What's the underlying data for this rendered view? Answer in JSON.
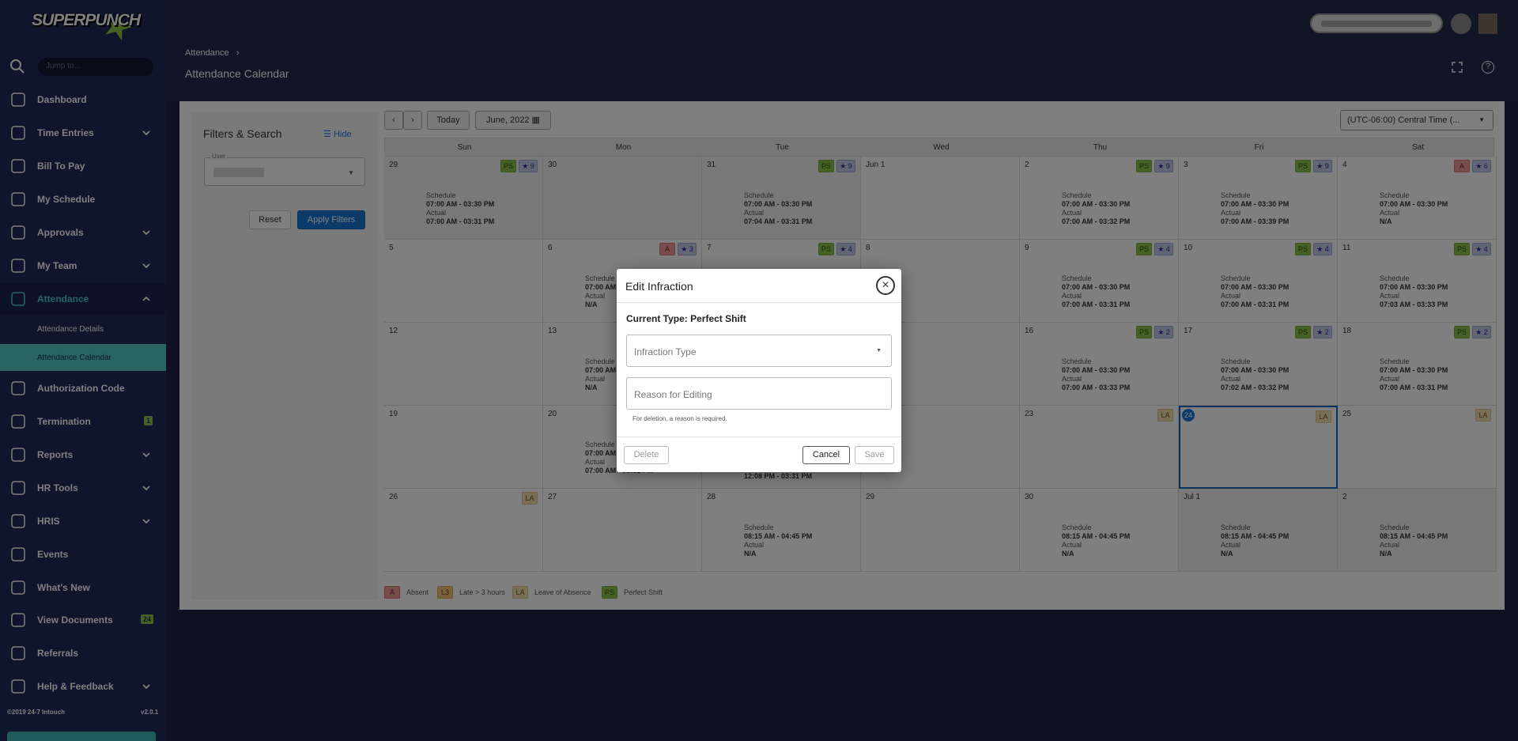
{
  "app": {
    "logo_text": "SUPERPUNCH"
  },
  "sidebar": {
    "jump_placeholder": "Jump to...",
    "items": [
      {
        "label": "Dashboard",
        "icon": "home-icon"
      },
      {
        "label": "Time Entries",
        "icon": "clock-icon"
      },
      {
        "label": "Bill To Pay",
        "icon": "bill-icon"
      },
      {
        "label": "My Schedule",
        "icon": "calendar-icon"
      },
      {
        "label": "Approvals",
        "icon": "clipboard-check-icon"
      },
      {
        "label": "My Team",
        "icon": "team-icon"
      },
      {
        "label": "Attendance",
        "icon": "calendar-check-icon"
      },
      {
        "label": "Authorization Code",
        "icon": "code-icon"
      },
      {
        "label": "Termination",
        "icon": "gear-icon"
      },
      {
        "label": "Reports",
        "icon": "chart-icon"
      },
      {
        "label": "HR Tools",
        "icon": "hr-tools-icon"
      },
      {
        "label": "HRIS",
        "icon": "badge-icon"
      },
      {
        "label": "Events",
        "icon": "events-icon"
      },
      {
        "label": "What's New",
        "icon": "bolt-icon"
      },
      {
        "label": "View Documents",
        "icon": "documents-icon"
      },
      {
        "label": "Referrals",
        "icon": "referral-icon"
      },
      {
        "label": "Help & Feedback",
        "icon": "help-icon"
      }
    ],
    "sub_items": [
      "Attendance Details",
      "Attendance Calendar"
    ],
    "termination_badge": "1",
    "documents_badge": "24",
    "copyright": "©2019 24-7 Intouch",
    "version": "v2.0.1"
  },
  "header": {
    "breadcrumb": "Attendance",
    "title": "Attendance Calendar"
  },
  "filters": {
    "title": "Filters & Search",
    "hide_label": "Hide",
    "user_label": "User",
    "reset_label": "Reset",
    "apply_label": "Apply Filters"
  },
  "calendar": {
    "prev": "‹",
    "next": "›",
    "today_label": "Today",
    "month_label": "June, 2022",
    "timezone": "(UTC-06:00) Central Time (...",
    "days_of_week": [
      "Sun",
      "Mon",
      "Tue",
      "Wed",
      "Thu",
      "Fri",
      "Sat"
    ],
    "schedule_label": "Schedule",
    "actual_label": "Actual",
    "weeks": [
      [
        {
          "day": "29",
          "shade": true,
          "tags": [
            "PS",
            "★ 9"
          ],
          "schedule": "07:00 AM  -  03:30 PM",
          "actual": "07:00 AM  -  03:31 PM"
        },
        {
          "day": "30",
          "shade": true,
          "tags": []
        },
        {
          "day": "31",
          "shade": true,
          "tags": [
            "PS",
            "★ 9"
          ],
          "schedule": "07:00 AM  -  03:30 PM",
          "actual": "07:04 AM  -  03:31 PM"
        },
        {
          "day": "Jun  1",
          "tags": []
        },
        {
          "day": "2",
          "tags": [
            "PS",
            "★ 9"
          ],
          "schedule": "07:00 AM  -  03:30 PM",
          "actual": "07:00 AM  -  03:32 PM"
        },
        {
          "day": "3",
          "tags": [
            "PS",
            "★ 9"
          ],
          "schedule": "07:00 AM  -  03:30 PM",
          "actual": "07:00 AM  -  03:39 PM"
        },
        {
          "day": "4",
          "tags": [
            "A",
            "★ 6"
          ],
          "schedule": "07:00 AM  -  03:30 PM",
          "actual": "N/A"
        }
      ],
      [
        {
          "day": "5",
          "tags": []
        },
        {
          "day": "6",
          "tags": [
            "A",
            "★ 3"
          ],
          "schedule": "07:00 AM",
          "actual": "N/A"
        },
        {
          "day": "7",
          "tags": [
            "PS",
            "★ 4"
          ]
        },
        {
          "day": "8",
          "tags": []
        },
        {
          "day": "9",
          "tags": [
            "PS",
            "★ 4"
          ],
          "schedule": "07:00 AM  -  03:30 PM",
          "actual": "07:00 AM  -  03:31 PM"
        },
        {
          "day": "10",
          "tags": [
            "PS",
            "★ 4"
          ],
          "schedule": "07:00 AM  -  03:30 PM",
          "actual": "07:00 AM  -  03:31 PM"
        },
        {
          "day": "11",
          "tags": [
            "PS",
            "★ 4"
          ],
          "schedule": "07:00 AM  -  03:30 PM",
          "actual": "07:03 AM  -  03:33 PM"
        }
      ],
      [
        {
          "day": "12",
          "tags": []
        },
        {
          "day": "13",
          "tags": [],
          "schedule": "07:00 AM",
          "actual": "N/A"
        },
        {
          "day": "",
          "tags": []
        },
        {
          "day": "",
          "tags": []
        },
        {
          "day": "16",
          "tags": [
            "PS",
            "★ 2"
          ],
          "schedule": "07:00 AM  -  03:30 PM",
          "actual": "07:00 AM  -  03:33 PM"
        },
        {
          "day": "17",
          "tags": [
            "PS",
            "★ 2"
          ],
          "schedule": "07:00 AM  -  03:30 PM",
          "actual": "07:02 AM  -  03:32 PM"
        },
        {
          "day": "18",
          "tags": [
            "PS",
            "★ 2"
          ],
          "schedule": "07:00 AM  -  03:30 PM",
          "actual": "07:00 AM  -  03:31 PM"
        }
      ],
      [
        {
          "day": "19",
          "tags": []
        },
        {
          "day": "20",
          "tags": [],
          "schedule": "07:00 AM",
          "actual": "07:00 AM  -  03:31 PM"
        },
        {
          "day": "",
          "tags": [],
          "actual_only": "12:08 PM  -  03:31 PM"
        },
        {
          "day": "",
          "tags": []
        },
        {
          "day": "23",
          "tags": [
            "LA"
          ]
        },
        {
          "day": "24",
          "today": true,
          "tags": [
            "LA"
          ]
        },
        {
          "day": "25",
          "tags": [
            "LA"
          ]
        }
      ],
      [
        {
          "day": "26",
          "tags": [
            "LA"
          ]
        },
        {
          "day": "27",
          "tags": []
        },
        {
          "day": "28",
          "tags": [],
          "schedule": "08:15 AM  -  04:45 PM",
          "actual": "N/A"
        },
        {
          "day": "29",
          "tags": []
        },
        {
          "day": "30",
          "tags": [],
          "schedule": "08:15 AM  -  04:45 PM",
          "actual": "N/A"
        },
        {
          "day": "Jul  1",
          "shade": true,
          "tags": [],
          "schedule": "08:15 AM  -  04:45 PM",
          "actual": "N/A"
        },
        {
          "day": "2",
          "shade": true,
          "tags": [],
          "schedule": "08:15 AM  -  04:45 PM",
          "actual": "N/A"
        }
      ]
    ]
  },
  "legend": [
    {
      "code": "A",
      "label": "Absent"
    },
    {
      "code": "L3",
      "label": "Late > 3 hours"
    },
    {
      "code": "LA",
      "label": "Leave of Absence"
    },
    {
      "code": "PS",
      "label": "Perfect Shift"
    }
  ],
  "modal": {
    "title": "Edit Infraction",
    "close": "×",
    "current_type": "Current Type: Perfect Shift",
    "infraction_placeholder": "Infraction Type",
    "reason_placeholder": "Reason for Editing",
    "help_text": "For deletion, a reason is required.",
    "delete_label": "Delete",
    "cancel_label": "Cancel",
    "save_label": "Save"
  }
}
